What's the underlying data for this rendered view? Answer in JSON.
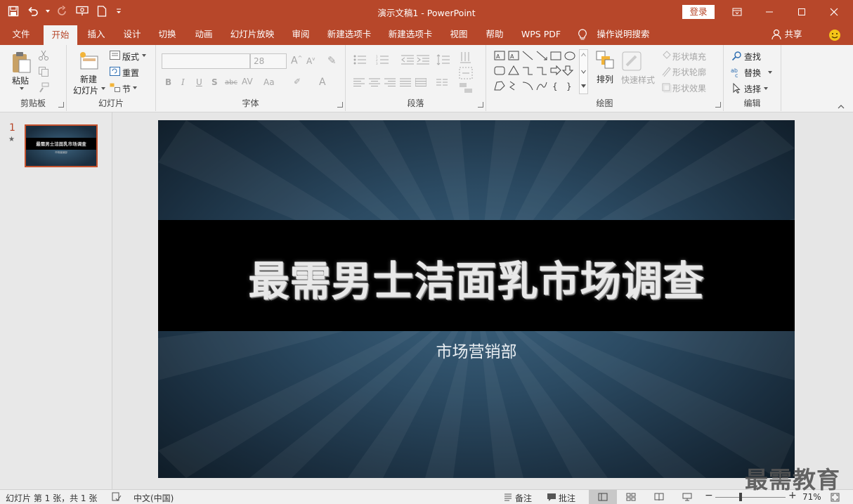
{
  "window": {
    "title": "演示文稿1 - PowerPoint",
    "login_label": "登录"
  },
  "tabs": [
    {
      "label": "文件"
    },
    {
      "label": "开始"
    },
    {
      "label": "插入"
    },
    {
      "label": "设计"
    },
    {
      "label": "切换"
    },
    {
      "label": "动画"
    },
    {
      "label": "幻灯片放映"
    },
    {
      "label": "审阅"
    },
    {
      "label": "新建选项卡"
    },
    {
      "label": "新建选项卡"
    },
    {
      "label": "视图"
    },
    {
      "label": "帮助"
    },
    {
      "label": "WPS PDF"
    },
    {
      "label": "操作说明搜索"
    }
  ],
  "share_label": "共享",
  "ribbon": {
    "clipboard": {
      "paste": "粘贴",
      "group": "剪贴板"
    },
    "slides": {
      "new_slide_1": "新建",
      "new_slide_2": "幻灯片",
      "layout": "版式",
      "reset": "重置",
      "section": "节",
      "group": "幻灯片"
    },
    "font": {
      "font_size": "28",
      "group": "字体"
    },
    "paragraph": {
      "group": "段落"
    },
    "drawing": {
      "arrange": "排列",
      "quick_styles": "快速样式",
      "shape_fill": "形状填充",
      "shape_outline": "形状轮廓",
      "shape_effects": "形状效果",
      "group": "绘图"
    },
    "editing": {
      "find": "查找",
      "replace": "替换",
      "select": "选择",
      "group": "编辑"
    }
  },
  "thumbnails": [
    {
      "number": "1",
      "star": "★",
      "title": "最需男士洁面乳市场调查",
      "subtitle": "市场营销部"
    }
  ],
  "slide": {
    "title": "最需男士洁面乳市场调查",
    "subtitle": "市场营销部"
  },
  "status": {
    "slide_info": "幻灯片 第 1 张，共 1 张",
    "language": "中文(中国)",
    "notes": "备注",
    "comments": "批注",
    "zoom": "71%"
  },
  "zoom_fraction": 0.71,
  "watermark": "最需教育",
  "colors": {
    "accent": "#b7472a",
    "ribbon_bg": "#f3f3f3",
    "slide_band": "#000000"
  }
}
